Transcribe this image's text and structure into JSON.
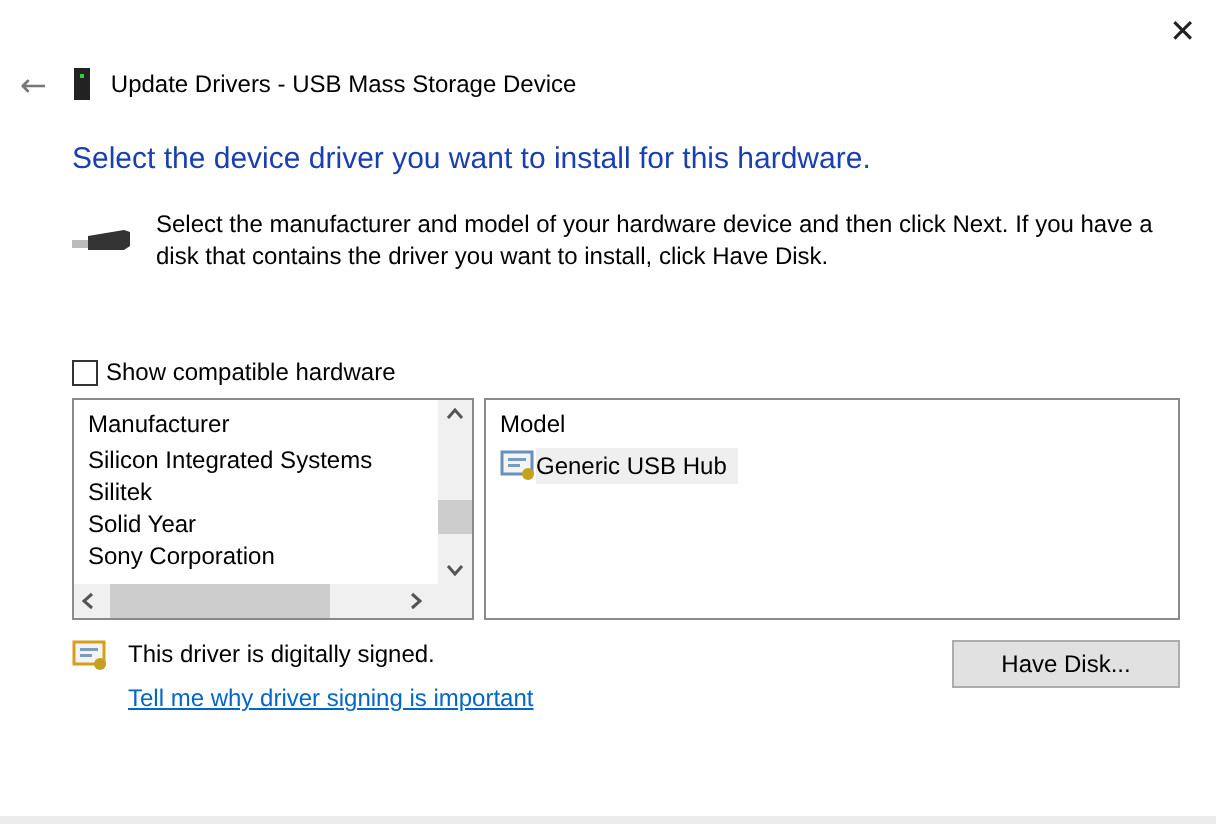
{
  "window": {
    "close": "✕",
    "back": "←",
    "title": "Update Drivers - USB Mass Storage Device"
  },
  "heading": "Select the device driver you want to install for this hardware.",
  "instructions": "Select the manufacturer and model of your hardware device and then click Next. If you have a disk that contains the driver you want to install, click Have Disk.",
  "show_compatible": {
    "label": "Show compatible hardware",
    "checked": false
  },
  "manufacturer_list": {
    "header": "Manufacturer",
    "items": [
      {
        "label": "Silicon Integrated Systems",
        "selected": false
      },
      {
        "label": "Silitek",
        "selected": false
      },
      {
        "label": "Solid Year",
        "selected": false
      },
      {
        "label": "Sony Corporation",
        "selected": false
      }
    ]
  },
  "model_list": {
    "header": "Model",
    "items": [
      {
        "label": "Generic USB Hub",
        "selected": true
      }
    ]
  },
  "signature": {
    "text": "This driver is digitally signed.",
    "link": "Tell me why driver signing is important"
  },
  "buttons": [
    "Have Disk..."
  ]
}
